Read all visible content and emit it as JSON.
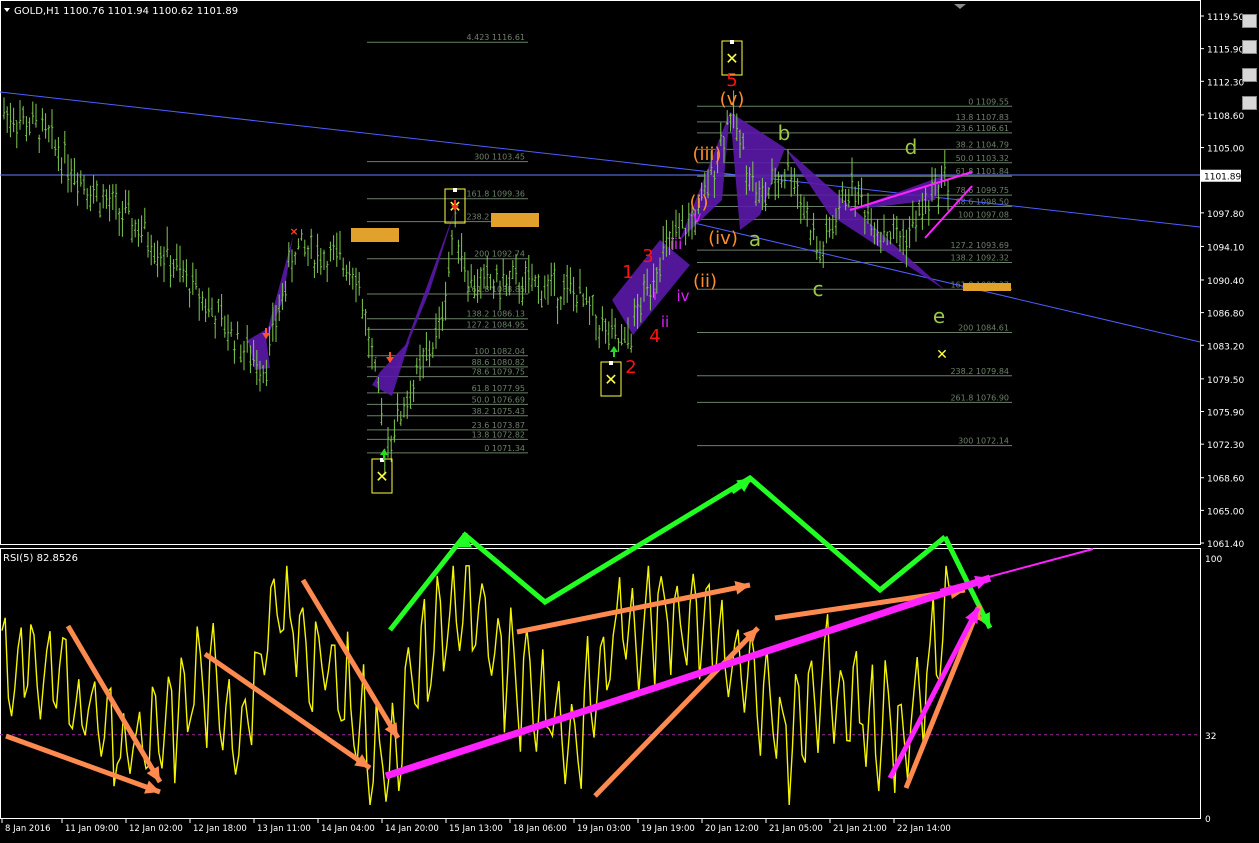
{
  "symbol_info": {
    "symbol": "GOLD,H1",
    "open": "1100.76",
    "high": "1101.94",
    "low": "1100.62",
    "close": "1101.89"
  },
  "current_price": "1101.89",
  "price_axis_labels": [
    "1119.50",
    "1115.90",
    "1112.30",
    "1108.60",
    "1105.00",
    "1097.80",
    "1094.10",
    "1090.40",
    "1086.80",
    "1083.20",
    "1079.50",
    "1075.90",
    "1072.30",
    "1068.60",
    "1065.00",
    "1061.40"
  ],
  "rsi_panel": {
    "title": "RSI(5) 82.8526",
    "axis_labels": [
      "100",
      "32",
      "0"
    ],
    "level": 32
  },
  "time_axis_labels": [
    "8 Jan 2016",
    "11 Jan 09:00",
    "12 Jan 02:00",
    "12 Jan 18:00",
    "13 Jan 11:00",
    "14 Jan 04:00",
    "14 Jan 20:00",
    "15 Jan 13:00",
    "18 Jan 06:00",
    "19 Jan 03:00",
    "19 Jan 19:00",
    "20 Jan 12:00",
    "21 Jan 05:00",
    "21 Jan 21:00",
    "22 Jan 14:00"
  ],
  "fib_set_1": [
    "4.423 1116.61",
    "300 1103.45",
    "161.8 1099.36",
    "238.2 1096.83",
    "200 1092.74",
    "161.8 1088.85",
    "138.2 1086.13",
    "127.2 1084.95",
    "100 1082.04",
    "88.6 1080.82",
    "78.6 1079.75",
    "61.8 1077.95",
    "50.0 1076.69",
    "38.2 1075.43",
    "23.6 1073.87",
    "13.8 1072.82",
    "0 1071.34"
  ],
  "fib_set_2": [
    "0 1109.55",
    "13.8 1107.83",
    "23.6 1106.61",
    "38.2 1104.79",
    "50.0 1103.32",
    "61.8 1101.84",
    "78.6 1099.75",
    "88.6 1098.50",
    "100 1097.08",
    "127.2 1093.69",
    "138.2 1092.32",
    "161.8 1089.37",
    "200 1084.61",
    "238.2 1079.84",
    "261.8 1076.90",
    "300 1072.14"
  ],
  "wave_labels": {
    "red": [
      "5",
      "1",
      "2",
      "3",
      "4"
    ],
    "orange": [
      "(v)",
      "(iii)",
      "(i)",
      "(iv)",
      "(ii)"
    ],
    "magenta": [
      "v",
      "iii",
      "i",
      "ii",
      "iv"
    ],
    "green": [
      "a",
      "b",
      "c",
      "d",
      "e"
    ]
  },
  "colors": {
    "background": "#000000",
    "axis_text": "#ffffff",
    "candle": "#7ec850",
    "channel": "#4d5eff",
    "pattern": "#5a1aa8",
    "fib": "#6b8068",
    "rsi_line": "#f5f500",
    "green_arrow": "#22ff22",
    "orange_arrow": "#ff8a50",
    "magenta_arrow": "#ff22ff",
    "label_red": "#ff1010",
    "label_orange": "#ff8c2a",
    "label_magenta": "#e020ff",
    "label_green": "#9bc84a",
    "rect_gold": "#e2a12b"
  }
}
